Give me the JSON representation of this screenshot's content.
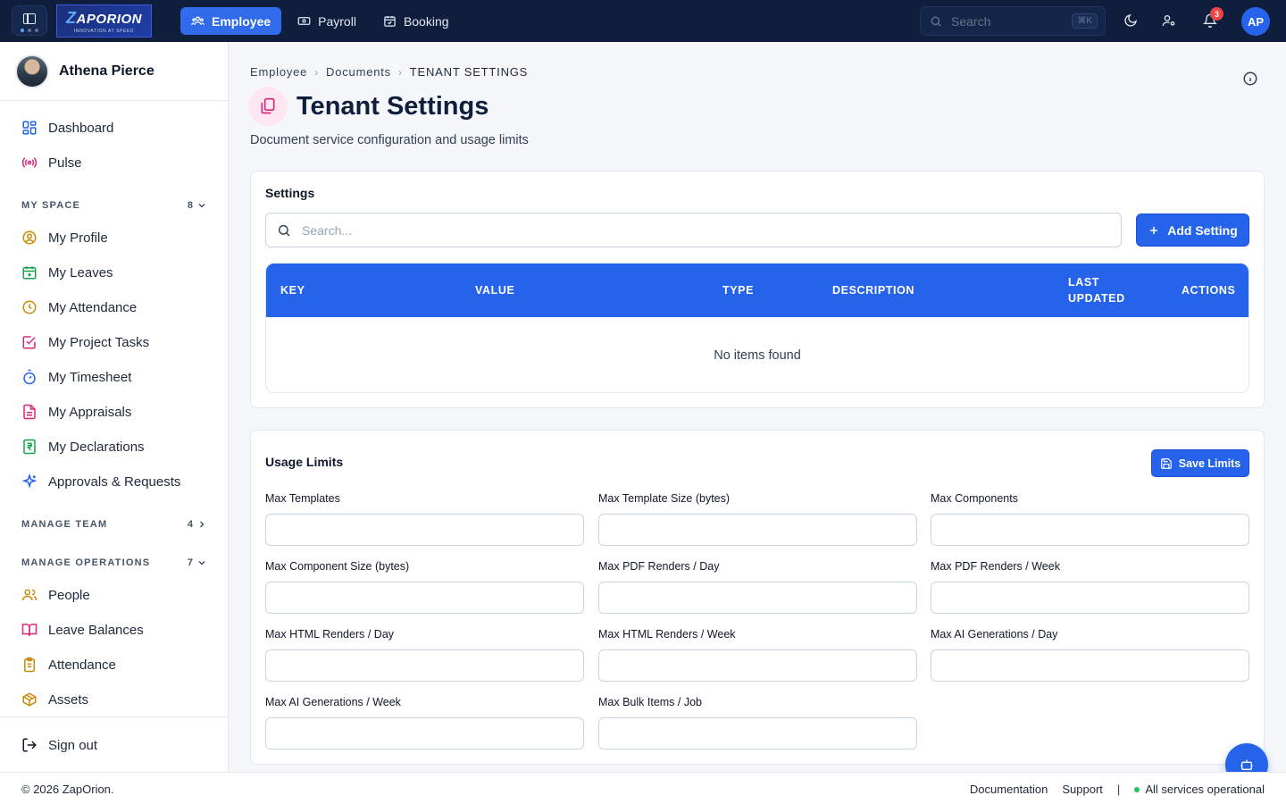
{
  "brand": {
    "logo_text": "ZAPORION",
    "logo_tagline": "INNOVATION AT SPEED"
  },
  "topbar": {
    "tabs": [
      {
        "label": "Employee",
        "icon": "users-icon",
        "active": true
      },
      {
        "label": "Payroll",
        "icon": "banknote-icon",
        "active": false
      },
      {
        "label": "Booking",
        "icon": "calendar-check-icon",
        "active": false
      }
    ],
    "search_placeholder": "Search",
    "search_shortcut": "⌘K",
    "notification_count": "3",
    "user_initials": "AP"
  },
  "sidebar": {
    "user_name": "Athena Pierce",
    "top_items": [
      {
        "label": "Dashboard",
        "icon": "grid-icon"
      },
      {
        "label": "Pulse",
        "icon": "broadcast-icon"
      }
    ],
    "sections": [
      {
        "title": "MY SPACE",
        "count": "8",
        "expanded": true
      },
      {
        "title": "MANAGE TEAM",
        "count": "4",
        "expanded": false
      },
      {
        "title": "MANAGE OPERATIONS",
        "count": "7",
        "expanded": true
      }
    ],
    "my_space_items": [
      {
        "label": "My Profile",
        "icon": "user-circle-icon"
      },
      {
        "label": "My Leaves",
        "icon": "calendar-plus-icon"
      },
      {
        "label": "My Attendance",
        "icon": "clock-icon"
      },
      {
        "label": "My Project Tasks",
        "icon": "check-square-icon"
      },
      {
        "label": "My Timesheet",
        "icon": "timer-icon"
      },
      {
        "label": "My Appraisals",
        "icon": "file-text-icon"
      },
      {
        "label": "My Declarations",
        "icon": "rupee-receipt-icon"
      },
      {
        "label": "Approvals & Requests",
        "icon": "sparkles-icon"
      }
    ],
    "operations_items": [
      {
        "label": "People",
        "icon": "people-icon"
      },
      {
        "label": "Leave Balances",
        "icon": "book-open-icon"
      },
      {
        "label": "Attendance",
        "icon": "clipboard-icon"
      },
      {
        "label": "Assets",
        "icon": "box-icon"
      }
    ],
    "signout_label": "Sign out"
  },
  "breadcrumb": [
    "Employee",
    "Documents",
    "TENANT SETTINGS"
  ],
  "page": {
    "title": "Tenant Settings",
    "subtitle": "Document service configuration and usage limits"
  },
  "settings_card": {
    "title": "Settings",
    "search_placeholder": "Search...",
    "add_button": "Add Setting",
    "columns": [
      "KEY",
      "VALUE",
      "TYPE",
      "DESCRIPTION",
      "LAST UPDATED",
      "ACTIONS"
    ],
    "empty_text": "No items found"
  },
  "limits_card": {
    "title": "Usage Limits",
    "save_button": "Save Limits",
    "fields": [
      {
        "label": "Max Templates",
        "value": ""
      },
      {
        "label": "Max Template Size (bytes)",
        "value": ""
      },
      {
        "label": "Max Components",
        "value": ""
      },
      {
        "label": "Max Component Size (bytes)",
        "value": ""
      },
      {
        "label": "Max PDF Renders / Day",
        "value": ""
      },
      {
        "label": "Max PDF Renders / Week",
        "value": ""
      },
      {
        "label": "Max HTML Renders / Day",
        "value": ""
      },
      {
        "label": "Max HTML Renders / Week",
        "value": ""
      },
      {
        "label": "Max AI Generations / Day",
        "value": ""
      },
      {
        "label": "Max AI Generations / Week",
        "value": ""
      },
      {
        "label": "Max Bulk Items / Job",
        "value": ""
      }
    ]
  },
  "footer": {
    "copyright": "© 2026 ZapOrion.",
    "documentation": "Documentation",
    "support": "Support",
    "status": "All services operational"
  },
  "colors": {
    "primary": "#2563eb",
    "topbar": "#0f1e3d",
    "status_ok": "#22c55e",
    "badge": "#ef4444"
  }
}
